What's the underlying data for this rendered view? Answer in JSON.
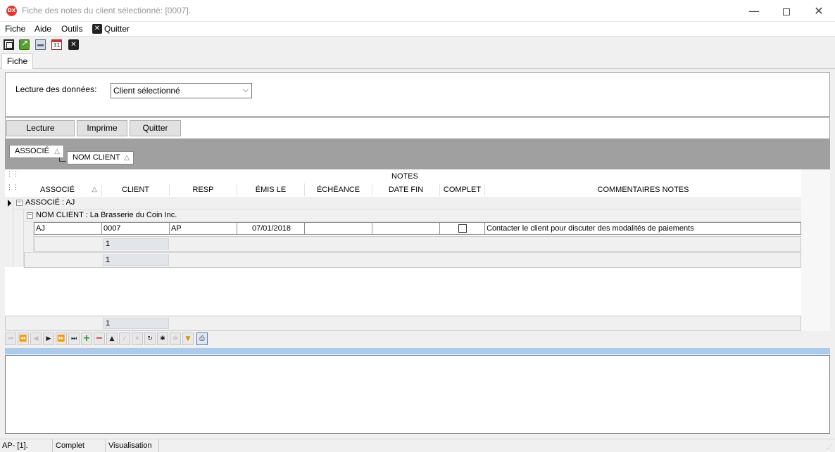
{
  "window": {
    "app_icon_text": "DX",
    "title": "Fiche des notes du client sélectionné: [0007].",
    "minimize_glyph": "—",
    "close_glyph": "✕"
  },
  "menu": {
    "items": [
      "Fiche",
      "Aide",
      "Outils"
    ],
    "quit_label": "Quitter",
    "quit_icon_glyph": "✕"
  },
  "toolbar": {
    "calendar_day": "31",
    "close_glyph": "✕"
  },
  "tabs": [
    {
      "label": "Fiche",
      "active": true
    }
  ],
  "filter": {
    "label": "Lecture des données:",
    "selected": "Client sélectionné"
  },
  "buttons": {
    "read": "Lecture",
    "print": "Imprime",
    "quit": "Quitter"
  },
  "group_by": {
    "levels": [
      "ASSOCIÉ",
      "NOM CLIENT"
    ],
    "sort_glyph": "△"
  },
  "grid": {
    "band": "NOTES",
    "columns": [
      "ASSOCIÉ",
      "CLIENT",
      "RESP",
      "ÉMIS LE",
      "ÉCHÉANCE",
      "DATE FIN",
      "COMPLET",
      "COMMENTAIRES NOTES"
    ],
    "group_level1": "ASSOCIÉ : AJ",
    "group_level2": "NOM CLIENT : La Brasserie du Coin Inc.",
    "rows": [
      {
        "associe": "AJ",
        "client": "0007",
        "resp": "AP",
        "emis_le": "07/01/2018",
        "echeance": "",
        "date_fin": "",
        "complet": false,
        "commentaires": "Contacter le client pour discuter des modalités de paiements"
      }
    ],
    "group2_count": "1",
    "group1_count": "1",
    "total_count": "1"
  },
  "navigator": {
    "first": "⏮",
    "prev_page": "⏪",
    "prev": "◀",
    "next": "▶",
    "next_page": "⏩",
    "last": "⏭",
    "insert": "+",
    "delete": "−",
    "edit": "▲",
    "post": "✓",
    "cancel": "✕",
    "refresh": "↻",
    "bookmark": "✱",
    "goto_bookmark": "✲",
    "filter": "▼",
    "print": "⎙"
  },
  "status": {
    "user": "AP- [1].",
    "state": "Complet",
    "mode": "Visualisation",
    "grip": "⋰"
  }
}
